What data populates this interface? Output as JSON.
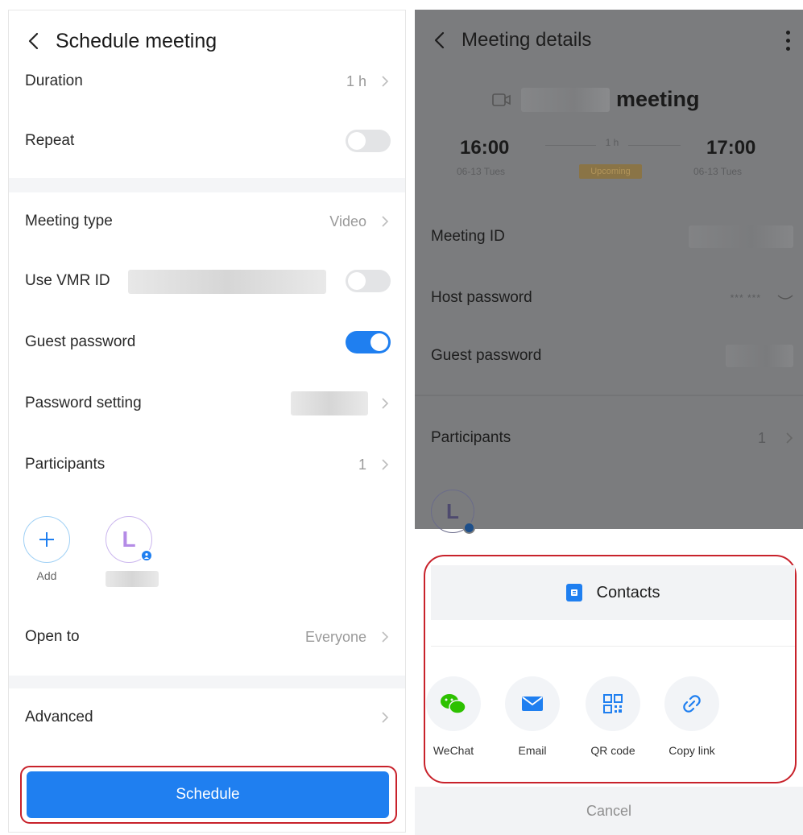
{
  "left": {
    "title": "Schedule meeting",
    "duration": {
      "label": "Duration",
      "value": "1 h"
    },
    "repeat": {
      "label": "Repeat",
      "on": false
    },
    "meeting_type": {
      "label": "Meeting type",
      "value": "Video"
    },
    "use_vmr": {
      "label": "Use VMR ID",
      "on": false
    },
    "guest_password": {
      "label": "Guest password",
      "on": true
    },
    "password_setting": {
      "label": "Password setting"
    },
    "participants": {
      "label": "Participants",
      "count": "1"
    },
    "add_label": "Add",
    "avatar_initial": "L",
    "open_to": {
      "label": "Open to",
      "value": "Everyone"
    },
    "advanced": {
      "label": "Advanced"
    },
    "schedule_button": "Schedule"
  },
  "right": {
    "title": "Meeting details",
    "meeting_word": "meeting",
    "start_time": "16:00",
    "start_date": "06-13 Tues",
    "end_time": "17:00",
    "end_date": "06-13 Tues",
    "duration": "1 h",
    "status": "Upcoming",
    "meeting_id": {
      "label": "Meeting ID"
    },
    "host_password": {
      "label": "Host password",
      "masked": "*** ***"
    },
    "guest_password": {
      "label": "Guest password"
    },
    "participants": {
      "label": "Participants",
      "count": "1"
    },
    "avatar_initial": "L",
    "share_sheet": {
      "contacts": "Contacts",
      "options": [
        {
          "label": "WeChat",
          "icon": "wechat-icon"
        },
        {
          "label": "Email",
          "icon": "email-icon"
        },
        {
          "label": "QR code",
          "icon": "qr-code-icon"
        },
        {
          "label": "Copy link",
          "icon": "link-icon"
        }
      ],
      "cancel": "Cancel"
    }
  },
  "colors": {
    "accent": "#1f7ff0",
    "highlight": "#c8222b",
    "wechat": "#2dc100",
    "dim_overlay": "#7b7c7e"
  }
}
